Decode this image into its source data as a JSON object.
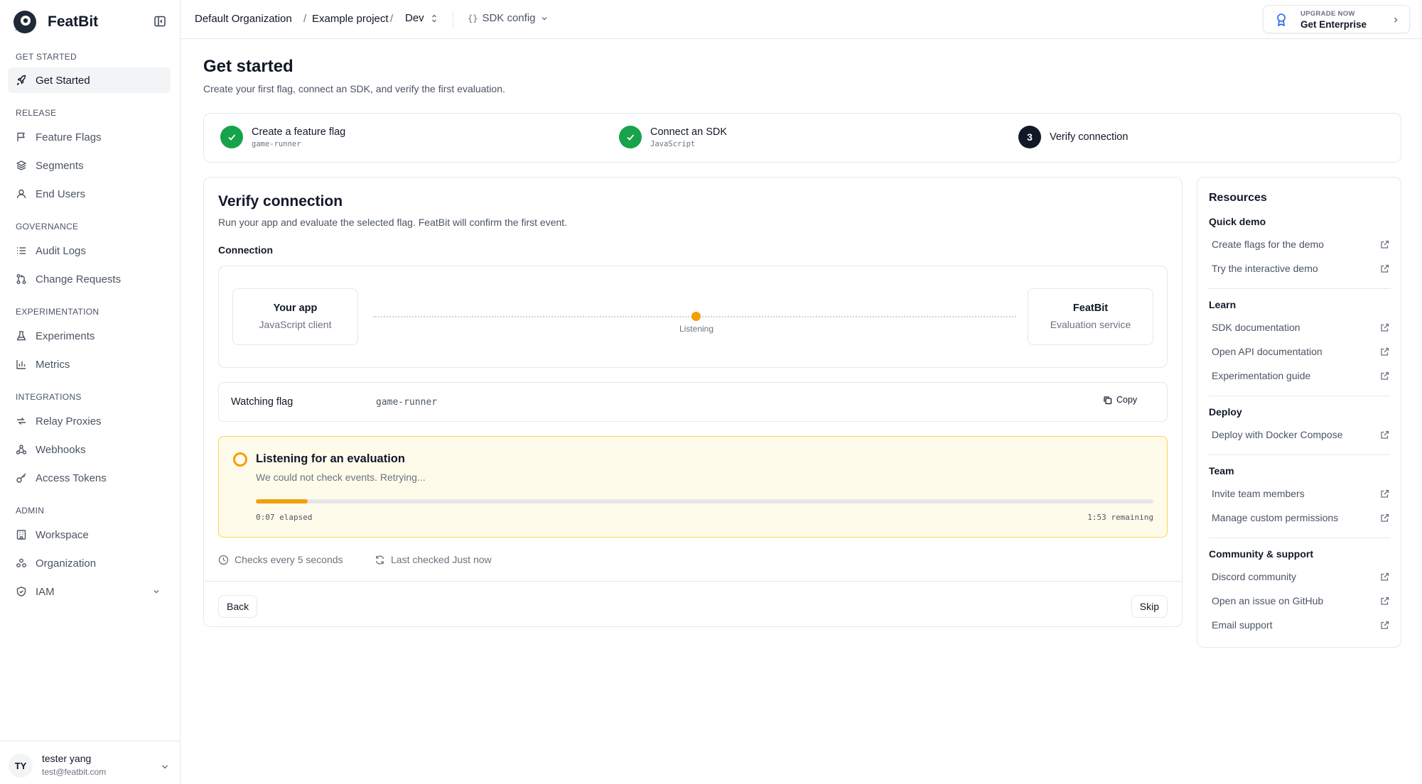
{
  "brand": {
    "name": "FeatBit"
  },
  "sidebar": {
    "sections": [
      {
        "label": "GET STARTED",
        "items": [
          {
            "label": "Get Started",
            "icon": "rocket-icon",
            "active": true
          }
        ]
      },
      {
        "label": "RELEASE",
        "items": [
          {
            "label": "Feature Flags",
            "icon": "flag-icon"
          },
          {
            "label": "Segments",
            "icon": "layers-icon"
          },
          {
            "label": "End Users",
            "icon": "user-icon"
          }
        ]
      },
      {
        "label": "GOVERNANCE",
        "items": [
          {
            "label": "Audit Logs",
            "icon": "list-icon"
          },
          {
            "label": "Change Requests",
            "icon": "git-pull-request-icon"
          }
        ]
      },
      {
        "label": "EXPERIMENTATION",
        "items": [
          {
            "label": "Experiments",
            "icon": "flask-icon"
          },
          {
            "label": "Metrics",
            "icon": "bar-chart-icon"
          }
        ]
      },
      {
        "label": "INTEGRATIONS",
        "items": [
          {
            "label": "Relay Proxies",
            "icon": "relay-icon"
          },
          {
            "label": "Webhooks",
            "icon": "webhook-icon"
          },
          {
            "label": "Access Tokens",
            "icon": "key-icon"
          }
        ]
      },
      {
        "label": "ADMIN",
        "items": [
          {
            "label": "Workspace",
            "icon": "building-icon"
          },
          {
            "label": "Organization",
            "icon": "organization-icon"
          },
          {
            "label": "IAM",
            "icon": "shield-icon"
          }
        ]
      }
    ]
  },
  "user": {
    "initials": "TY",
    "name": "tester yang",
    "email": "test@featbit.com"
  },
  "topbar": {
    "org": "Default Organization",
    "project": "Example project",
    "separator": "/",
    "env": "Dev",
    "sdk_config_brace": "{}",
    "sdk_config": "SDK config",
    "upgrade_small": "UPGRADE NOW",
    "upgrade_main": "Get Enterprise"
  },
  "page": {
    "title": "Get started",
    "subtitle": "Create your first flag, connect an SDK, and verify the first evaluation."
  },
  "steps": [
    {
      "title": "Create a feature flag",
      "sub": "game-runner",
      "status": "done"
    },
    {
      "title": "Connect an SDK",
      "sub": "JavaScript",
      "status": "done"
    },
    {
      "number": "3",
      "title": "Verify connection",
      "status": "current"
    }
  ],
  "verify": {
    "title": "Verify connection",
    "subtitle": "Run your app and evaluate the selected flag. FeatBit will confirm the first event.",
    "connection_label": "Connection",
    "app_node": {
      "title": "Your app",
      "sub": "JavaScript client"
    },
    "server_node": {
      "title": "FeatBit",
      "sub": "Evaluation service"
    },
    "status": "Listening",
    "watching_label": "Watching flag",
    "watching_key": "game-runner",
    "copy_label": "Copy",
    "listen_title": "Listening for an evaluation",
    "listen_sub": "We could not check events. Retrying...",
    "progress_percent": 5.8,
    "elapsed": "0:07 elapsed",
    "remaining": "1:53 remaining",
    "checks_every": "Checks every 5 seconds",
    "last_checked": "Last checked Just now",
    "back_label": "Back",
    "skip_label": "Skip",
    "accent_color": "#f59e0b",
    "success_color": "#16a34a"
  },
  "resources": {
    "title": "Resources",
    "groups": [
      {
        "title": "Quick demo",
        "links": [
          "Create flags for the demo",
          "Try the interactive demo"
        ]
      },
      {
        "title": "Learn",
        "links": [
          "SDK documentation",
          "Open API documentation",
          "Experimentation guide"
        ]
      },
      {
        "title": "Deploy",
        "links": [
          "Deploy with Docker Compose"
        ]
      },
      {
        "title": "Team",
        "links": [
          "Invite team members",
          "Manage custom permissions"
        ]
      },
      {
        "title": "Community & support",
        "links": [
          "Discord community",
          "Open an issue on GitHub",
          "Email support"
        ]
      }
    ]
  }
}
